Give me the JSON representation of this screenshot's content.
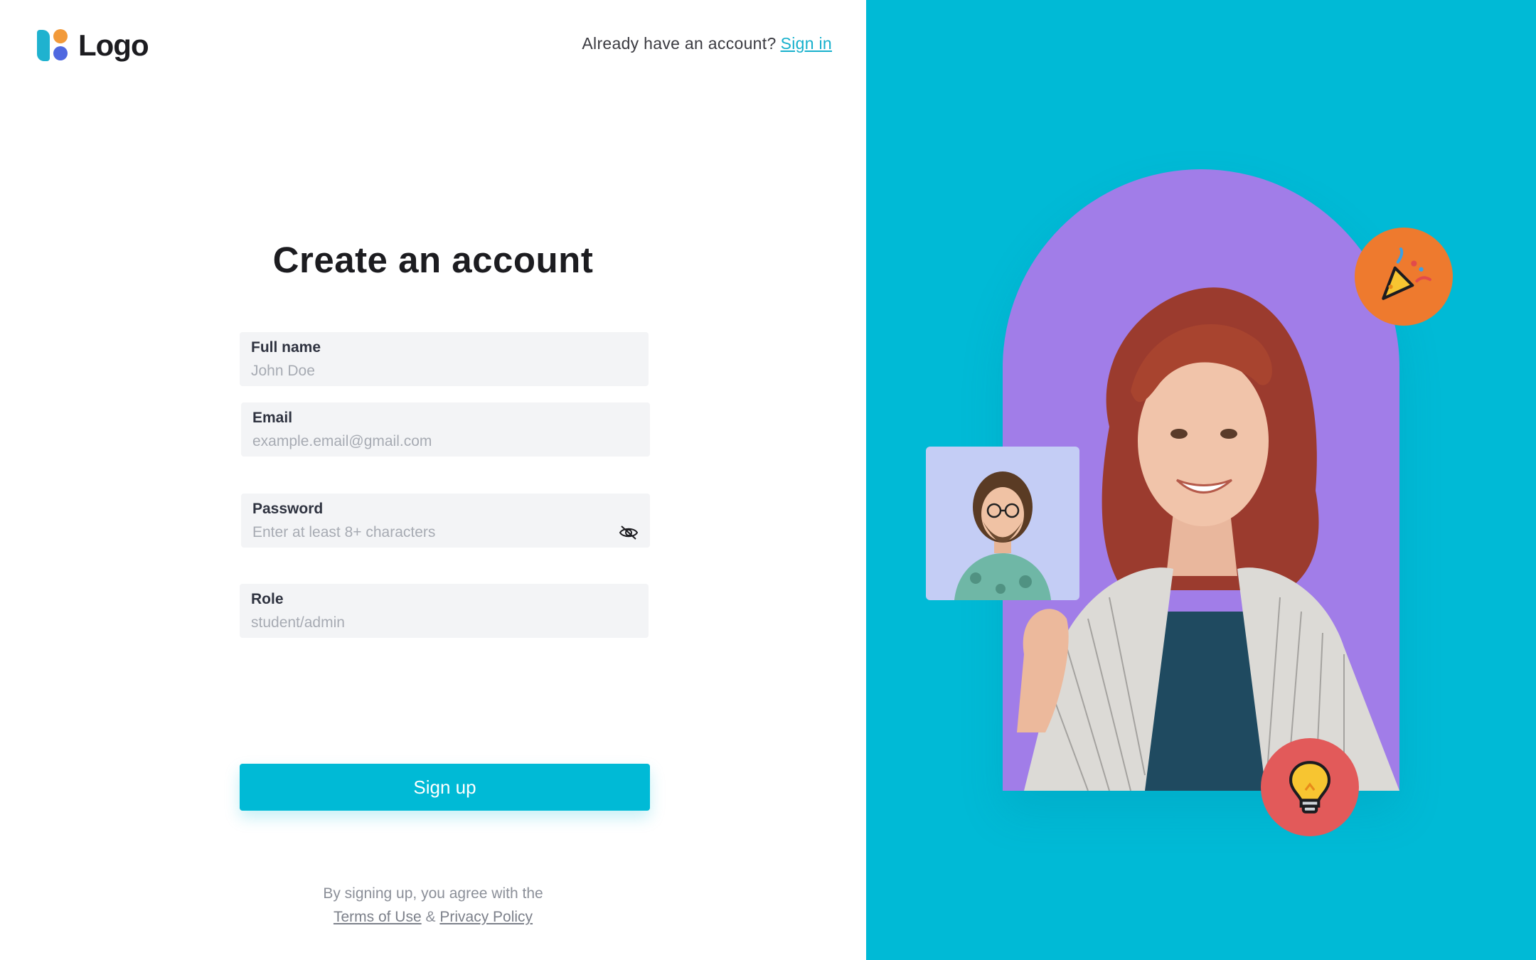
{
  "brand": {
    "logo_text": "Logo"
  },
  "header": {
    "prompt": "Already have an account?",
    "signin_label": "Sign in"
  },
  "form": {
    "title": "Create an account",
    "fields": [
      {
        "label": "Full name",
        "placeholder": "John Doe",
        "value": ""
      },
      {
        "label": "Email",
        "placeholder": "example.email@gmail.com",
        "value": ""
      },
      {
        "label": "Password",
        "placeholder": "Enter at least 8+ characters",
        "value": ""
      },
      {
        "label": "Role",
        "placeholder": "student/admin",
        "value": ""
      }
    ],
    "submit_label": "Sign up"
  },
  "terms": {
    "text": "By signing up, you agree with the",
    "terms_label": "Terms of Use",
    "separator": "&",
    "privacy_label": "Privacy Policy"
  },
  "colors": {
    "accent": "#00bad6",
    "arch": "#a17de8",
    "badge_party": "#ee7a2e",
    "badge_bulb": "#e25a5a",
    "card_bg": "#c4cdf5"
  },
  "icons": {
    "password_toggle": "eye-off-icon",
    "badge_top": "party-popper-icon",
    "badge_bottom": "lightbulb-icon"
  }
}
